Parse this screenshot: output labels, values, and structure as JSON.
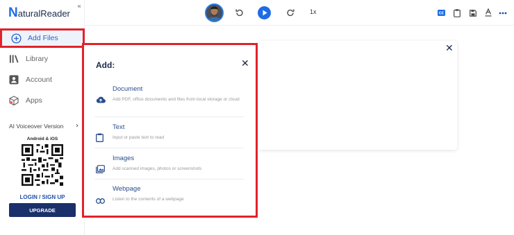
{
  "sidebar": {
    "logo_initial": "N",
    "logo_text": "aturalReader",
    "collapse_glyph": "«",
    "nav": [
      {
        "label": "Add Files",
        "icon": "plus-circle-icon"
      },
      {
        "label": "Library",
        "icon": "library-icon"
      },
      {
        "label": "Account",
        "icon": "account-icon"
      },
      {
        "label": "Apps",
        "icon": "apps-icon"
      }
    ],
    "voiceover_label": "AI Voiceover Version",
    "platforms": "Android & iOS",
    "login_label": "LOGIN / SIGN UP",
    "upgrade_label": "UPGRADE"
  },
  "player": {
    "speed": "1x",
    "icons": [
      "rewind-icon",
      "play-icon",
      "forward-icon"
    ]
  },
  "toolbar_icons": [
    "cc-icon",
    "clipboard-icon",
    "save-icon",
    "text-style-icon",
    "more-icon"
  ],
  "dialog": {
    "title": "Add:",
    "options": [
      {
        "title": "Document",
        "description": "Add PDF, office documents and files from local storage or cloud",
        "icon": "cloud-upload-icon"
      },
      {
        "title": "Text",
        "description": "Input or paste text to read",
        "icon": "clipboard-icon"
      },
      {
        "title": "Images",
        "description": "Add scanned images, photos or screenshots",
        "icon": "image-icon"
      },
      {
        "title": "Webpage",
        "description": "Listen to the contents of a webpage",
        "icon": "link-icon"
      }
    ]
  },
  "colors": {
    "brand": "#1e6de5",
    "highlight": "#e0222a",
    "upgrade_bg": "#1b2f6b",
    "title_text": "#1b2a4a"
  }
}
